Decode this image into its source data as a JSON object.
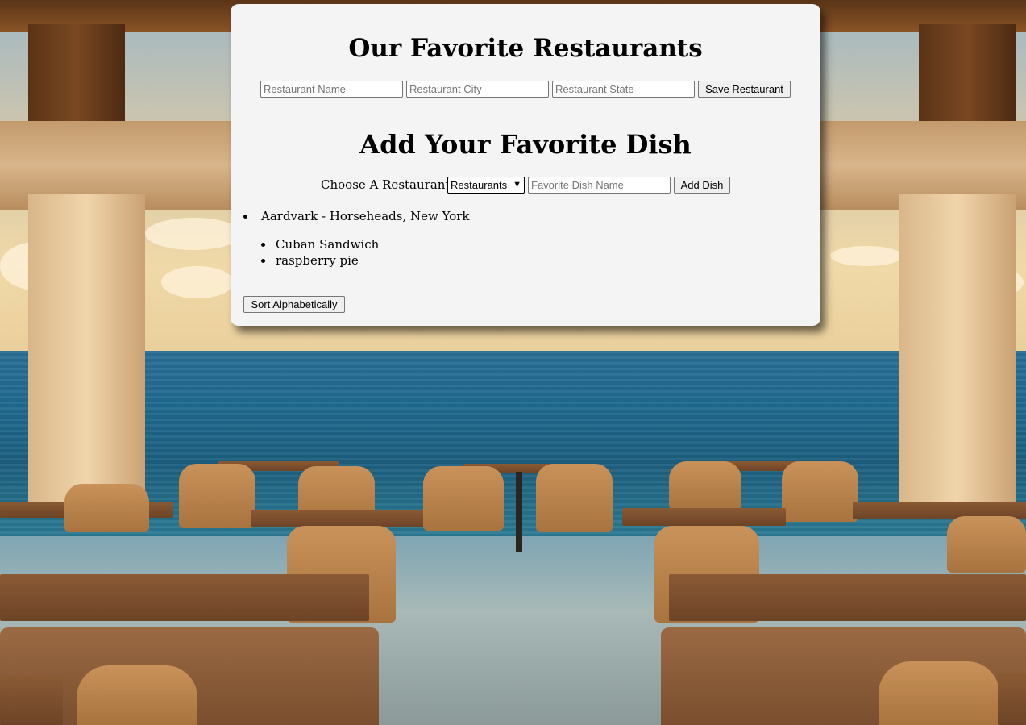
{
  "background": {
    "description_icon": "restaurant-ocean-view-photo"
  },
  "restaurant_form": {
    "title": "Our Favorite Restaurants",
    "name_placeholder": "Restaurant Name",
    "city_placeholder": "Restaurant City",
    "state_placeholder": "Restaurant State",
    "save_label": "Save Restaurant"
  },
  "dish_form": {
    "title": "Add Your Favorite Dish",
    "choose_label": "Choose A Restaurant:",
    "select_value": "Restaurants",
    "dish_placeholder": "Favorite Dish Name",
    "add_label": "Add Dish"
  },
  "restaurants": [
    {
      "label": "Aardvark - Horseheads, New York",
      "dishes": [
        "Cuban Sandwich",
        "raspberry pie"
      ]
    }
  ],
  "sort_label": "Sort Alphabetically"
}
